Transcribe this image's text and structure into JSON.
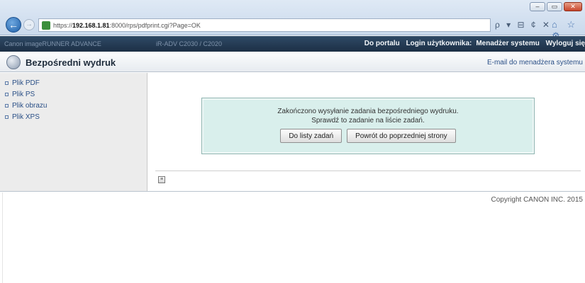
{
  "browser": {
    "url_prefix": "https://",
    "url_host": "192.168.1.81",
    "url_rest": ":8000/rps/pdfprint.cgi?Page=OK",
    "addr_tools": "ρ ▾ ⊟ ¢ ✕",
    "fav_tools": "⌂ ☆ ⚙",
    "window": {
      "min": "–",
      "max": "▭",
      "close": "✕"
    },
    "back_glyph": "←",
    "fwd_glyph": "→"
  },
  "portal": {
    "left_text": "Canon imageRUNNER ADVANCE",
    "mid_text": "iR-ADV C2030 / C2020",
    "to_portal": "Do portalu",
    "login_label": "Login użytkownika:",
    "user_name": "Menadżer systemu",
    "logout": "Wyloguj się"
  },
  "header": {
    "title": "Bezpośredni wydruk",
    "admin_email": "E-mail do menadżera systemu"
  },
  "sidebar": {
    "items": [
      {
        "label": "Plik PDF"
      },
      {
        "label": "Plik PS"
      },
      {
        "label": "Plik obrazu"
      },
      {
        "label": "Plik XPS"
      }
    ]
  },
  "message": {
    "line1": "Zakończono wysyłanie zadania bezpośredniego wydruku.",
    "line2": "Sprawdź to zadanie na liście zadań.",
    "btn_jobs": "Do listy zadań",
    "btn_back": "Powrót do poprzedniej strony"
  },
  "main": {
    "scroll_glyph": "≡"
  },
  "footer": {
    "copyright": "Copyright CANON INC. 2015"
  }
}
